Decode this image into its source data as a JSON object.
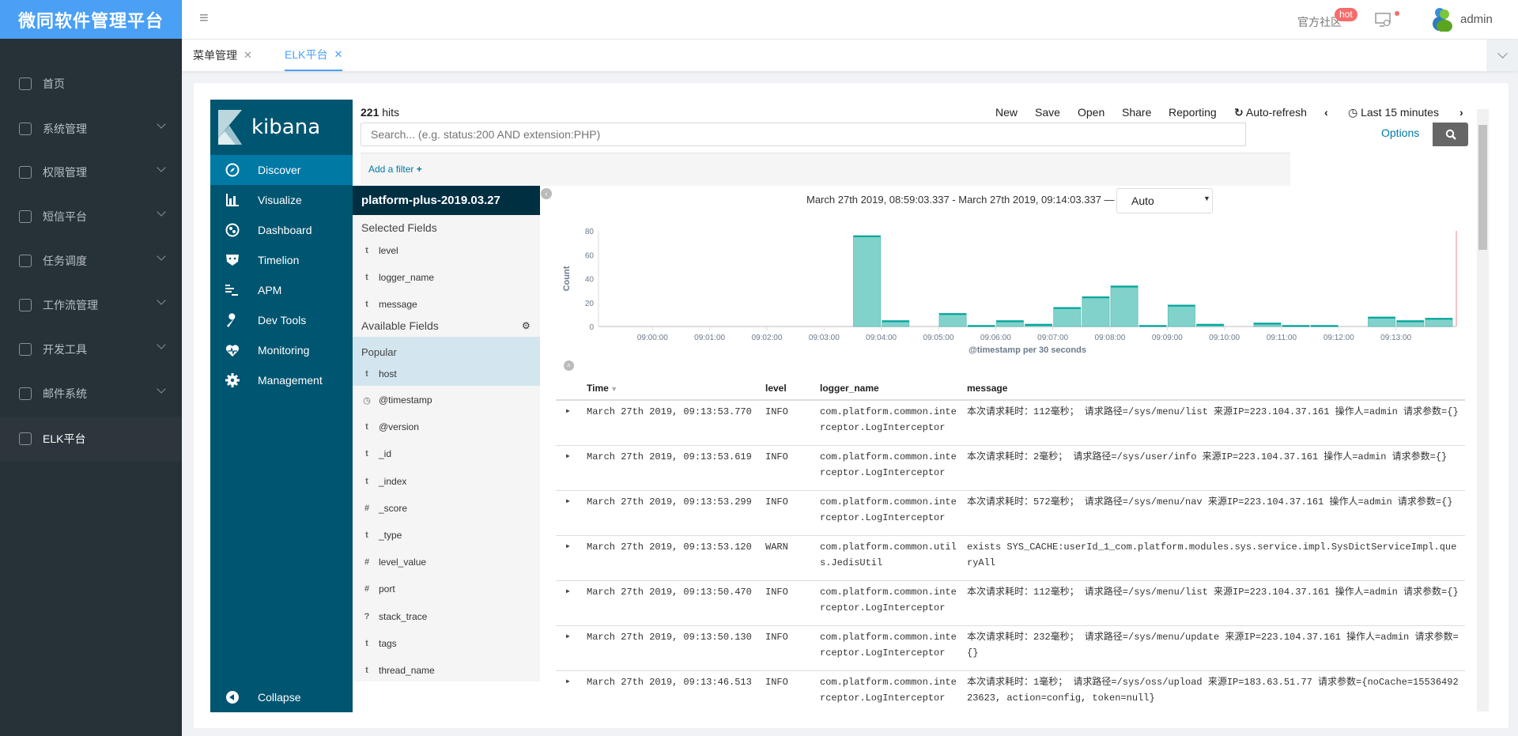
{
  "app": {
    "title": "微同软件管理平台",
    "community": "官方社区",
    "hot_badge": "hot",
    "user": "admin"
  },
  "sidebar": {
    "items": [
      {
        "label": "首页",
        "icon": "home-icon",
        "expandable": false
      },
      {
        "label": "系统管理",
        "icon": "gear-icon",
        "expandable": true
      },
      {
        "label": "权限管理",
        "icon": "user-key-icon",
        "expandable": true
      },
      {
        "label": "短信平台",
        "icon": "message-icon",
        "expandable": true
      },
      {
        "label": "任务调度",
        "icon": "schedule-icon",
        "expandable": true
      },
      {
        "label": "工作流管理",
        "icon": "workflow-icon",
        "expandable": true
      },
      {
        "label": "开发工具",
        "icon": "code-icon",
        "expandable": true
      },
      {
        "label": "邮件系统",
        "icon": "mail-icon",
        "expandable": true
      },
      {
        "label": "ELK平台",
        "icon": "document-gear-icon",
        "expandable": false,
        "active": true
      }
    ]
  },
  "tabs": [
    {
      "label": "菜单管理",
      "active": false
    },
    {
      "label": "ELK平台",
      "active": true
    }
  ],
  "kibana": {
    "logo": "kibana",
    "nav": [
      {
        "label": "Discover",
        "icon": "compass-icon",
        "active": true
      },
      {
        "label": "Visualize",
        "icon": "bar-chart-icon"
      },
      {
        "label": "Dashboard",
        "icon": "dashboard-icon"
      },
      {
        "label": "Timelion",
        "icon": "timelion-icon"
      },
      {
        "label": "APM",
        "icon": "apm-icon"
      },
      {
        "label": "Dev Tools",
        "icon": "wrench-icon"
      },
      {
        "label": "Monitoring",
        "icon": "heartbeat-icon"
      },
      {
        "label": "Management",
        "icon": "gear-icon"
      }
    ],
    "collapse": "Collapse",
    "hits_count": "221",
    "hits_label": "hits",
    "menu": {
      "new": "New",
      "save": "Save",
      "open": "Open",
      "share": "Share",
      "reporting": "Reporting",
      "auto_refresh": "Auto-refresh",
      "time": "Last 15 minutes"
    },
    "search": {
      "placeholder": "Search... (e.g. status:200 AND extension:PHP)",
      "value": "",
      "options": "Options"
    },
    "add_filter": "Add a filter",
    "index": "platform-plus-2019.03.27",
    "selected_fields_title": "Selected Fields",
    "selected_fields": [
      {
        "type": "t",
        "name": "level"
      },
      {
        "type": "t",
        "name": "logger_name"
      },
      {
        "type": "t",
        "name": "message"
      }
    ],
    "available_fields_title": "Available Fields",
    "popular_label": "Popular",
    "popular_fields": [
      {
        "type": "t",
        "name": "host"
      }
    ],
    "available_fields": [
      {
        "type": "clock",
        "name": "@timestamp"
      },
      {
        "type": "t",
        "name": "@version"
      },
      {
        "type": "t",
        "name": "_id"
      },
      {
        "type": "t",
        "name": "_index"
      },
      {
        "type": "#",
        "name": "_score"
      },
      {
        "type": "t",
        "name": "_type"
      },
      {
        "type": "#",
        "name": "level_value"
      },
      {
        "type": "#",
        "name": "port"
      },
      {
        "type": "?",
        "name": "stack_trace"
      },
      {
        "type": "t",
        "name": "tags"
      },
      {
        "type": "t",
        "name": "thread_name"
      }
    ],
    "time_range": "March 27th 2019, 08:59:03.337 - March 27th 2019, 09:14:03.337 —",
    "interval": "Auto"
  },
  "chart_data": {
    "type": "bar",
    "ylabel": "Count",
    "xlabel": "@timestamp per 30 seconds",
    "ylim": [
      0,
      80
    ],
    "yticks": [
      0,
      20,
      40,
      60,
      80
    ],
    "xlim": [
      "08:59:03.337",
      "09:14:03.337"
    ],
    "xticks": [
      "09:00:00",
      "09:01:00",
      "09:02:00",
      "09:03:00",
      "09:04:00",
      "09:05:00",
      "09:06:00",
      "09:07:00",
      "09:08:00",
      "09:09:00",
      "09:10:00",
      "09:11:00",
      "09:12:00",
      "09:13:00"
    ],
    "categories": [
      "09:03:30",
      "09:04:00",
      "09:04:30",
      "09:05:00",
      "09:05:30",
      "09:06:00",
      "09:06:30",
      "09:07:00",
      "09:07:30",
      "09:08:00",
      "09:08:30",
      "09:09:00",
      "09:09:30",
      "09:10:00",
      "09:10:30",
      "09:11:00",
      "09:11:30",
      "09:12:00",
      "09:12:30",
      "09:13:00",
      "09:13:30"
    ],
    "values": [
      76,
      5,
      0,
      11,
      1,
      5,
      2,
      16,
      25,
      34,
      1,
      18,
      2,
      0,
      3,
      1,
      1,
      0,
      8,
      5,
      7
    ],
    "color": "#82d2cc",
    "grid": false
  },
  "table": {
    "columns": [
      "Time",
      "level",
      "logger_name",
      "message"
    ],
    "rows": [
      {
        "time": "March 27th 2019, 09:13:53.770",
        "level": "INFO",
        "logger": "com.platform.common.interceptor.LogInterceptor",
        "message": "本次请求耗时：112毫秒； 请求路径=/sys/menu/list 来源IP=223.104.37.161 操作人=admin 请求参数={}"
      },
      {
        "time": "March 27th 2019, 09:13:53.619",
        "level": "INFO",
        "logger": "com.platform.common.interceptor.LogInterceptor",
        "message": "本次请求耗时：2毫秒； 请求路径=/sys/user/info 来源IP=223.104.37.161 操作人=admin 请求参数={}"
      },
      {
        "time": "March 27th 2019, 09:13:53.299",
        "level": "INFO",
        "logger": "com.platform.common.interceptor.LogInterceptor",
        "message": "本次请求耗时：572毫秒； 请求路径=/sys/menu/nav 来源IP=223.104.37.161 操作人=admin 请求参数={}"
      },
      {
        "time": "March 27th 2019, 09:13:53.120",
        "level": "WARN",
        "logger": "com.platform.common.utils.JedisUtil",
        "message": "exists SYS_CACHE:userId_1_com.platform.modules.sys.service.impl.SysDictServiceImpl.queryAll"
      },
      {
        "time": "March 27th 2019, 09:13:50.470",
        "level": "INFO",
        "logger": "com.platform.common.interceptor.LogInterceptor",
        "message": "本次请求耗时：112毫秒； 请求路径=/sys/menu/list 来源IP=223.104.37.161 操作人=admin 请求参数={}"
      },
      {
        "time": "March 27th 2019, 09:13:50.130",
        "level": "INFO",
        "logger": "com.platform.common.interceptor.LogInterceptor",
        "message": "本次请求耗时：232毫秒； 请求路径=/sys/menu/update 来源IP=223.104.37.161 操作人=admin 请求参数={}"
      },
      {
        "time": "March 27th 2019, 09:13:46.513",
        "level": "INFO",
        "logger": "com.platform.common.interceptor.LogInterceptor",
        "message": "本次请求耗时：1毫秒； 请求路径=/sys/oss/upload 来源IP=183.63.51.77 请求参数={noCache=1553649223623, action=config, token=null}"
      }
    ]
  }
}
